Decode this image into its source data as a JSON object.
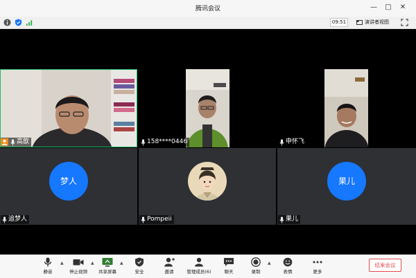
{
  "window": {
    "title": "腾讯会议"
  },
  "infobar": {
    "time": "09:51",
    "speaker_view_label": "演讲者视图"
  },
  "participants": [
    {
      "name": "高歆",
      "host": true,
      "active": true,
      "video": true
    },
    {
      "name": "158****0446",
      "video": true
    },
    {
      "name": "申怀飞",
      "video": true
    },
    {
      "name": "追梦人",
      "video": false,
      "avatar_text": "梦人",
      "avatar_color": "#1677ff"
    },
    {
      "name": "Pompeii",
      "video": false,
      "avatar_kind": "illustration"
    },
    {
      "name": "果儿",
      "video": false,
      "avatar_text": "果儿",
      "avatar_color": "#1677ff"
    }
  ],
  "toolbar": {
    "items": [
      {
        "label": "静音",
        "icon": "mic-icon"
      },
      {
        "label": "停止视频",
        "icon": "camera-icon"
      },
      {
        "label": "共享屏幕",
        "icon": "share-screen-icon"
      },
      {
        "label": "安全",
        "icon": "shield-icon"
      },
      {
        "label": "邀请",
        "icon": "invite-icon"
      },
      {
        "label": "管理成员(6)",
        "icon": "members-icon"
      },
      {
        "label": "聊天",
        "icon": "chat-icon"
      },
      {
        "label": "录制",
        "icon": "record-icon"
      },
      {
        "label": "表情",
        "icon": "emoji-icon"
      },
      {
        "label": "更多",
        "icon": "more-icon"
      }
    ],
    "end_label": "结束会议"
  },
  "colors": {
    "accent": "#1677ff",
    "active_border": "#1fbf6b",
    "end_red": "#e14a4a",
    "host_orange": "#f28c1e"
  }
}
